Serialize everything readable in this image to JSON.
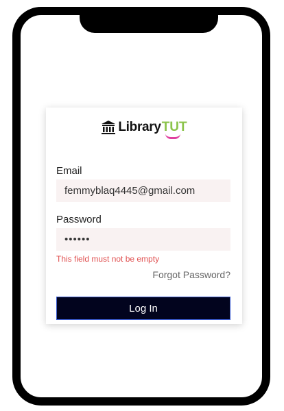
{
  "logo": {
    "text": "Library",
    "accent": "TUT",
    "accent_color": "#8bc34a",
    "smile_color": "#e040a0"
  },
  "form": {
    "email_label": "Email",
    "email_value": "femmyblaq4445@gmail.com",
    "password_label": "Password",
    "password_value": "••••••",
    "error_message": "This field must not be empty",
    "forgot_link": "Forgot Password?",
    "login_button": "Log In"
  },
  "colors": {
    "button_bg": "#02041e",
    "input_bg": "#f9f2f2",
    "error": "#e05050"
  }
}
